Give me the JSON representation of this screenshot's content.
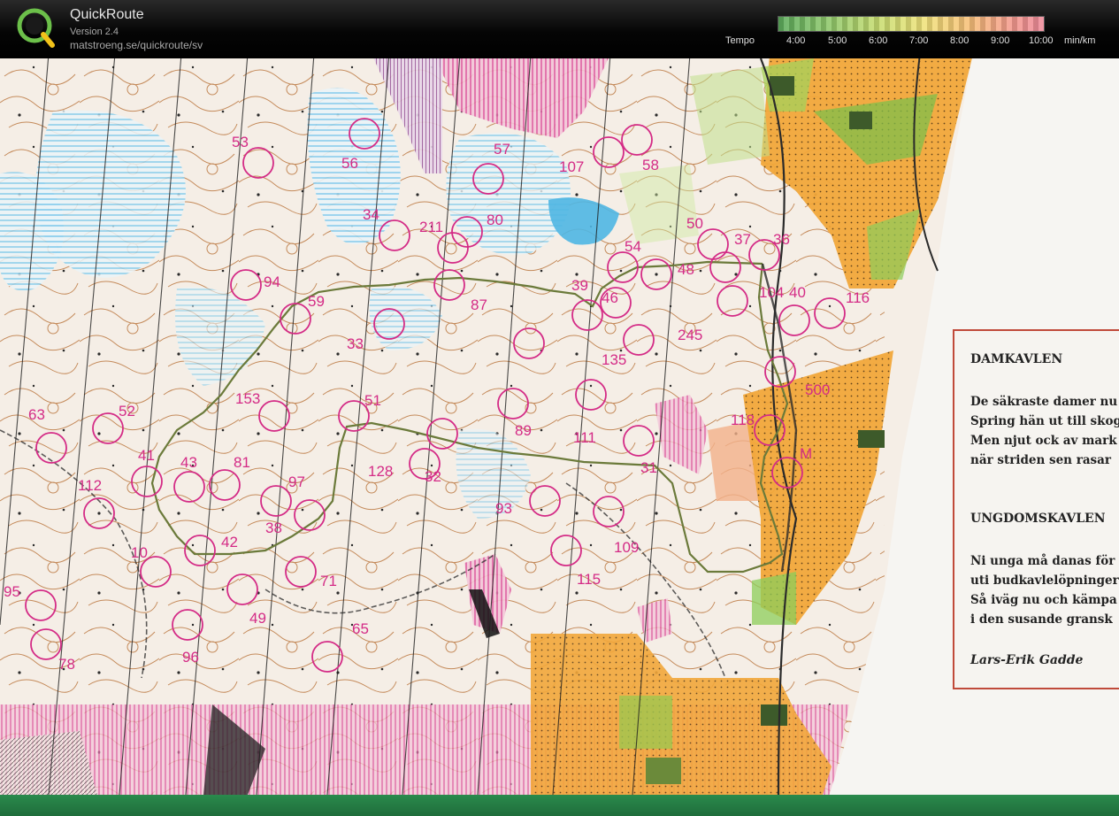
{
  "app": {
    "name": "QuickRoute",
    "version": "Version 2.4",
    "url": "matstroeng.se/quickroute/sv",
    "logo_letter": "Q"
  },
  "tempo": {
    "label": "Tempo",
    "ticks": [
      "4:00",
      "5:00",
      "6:00",
      "7:00",
      "8:00",
      "9:00",
      "10:00"
    ],
    "unit": "min/km",
    "colors": [
      "#5cab5c",
      "#c8dd70",
      "#f0e27a",
      "#f49a8e"
    ]
  },
  "map": {
    "control_labels": [
      "56",
      "57",
      "107",
      "58",
      "53",
      "34",
      "211",
      "80",
      "54",
      "50",
      "37",
      "36",
      "94",
      "59",
      "87",
      "39",
      "46",
      "48",
      "104",
      "40",
      "116",
      "33",
      "135",
      "245",
      "153",
      "51",
      "500",
      "63",
      "52",
      "89",
      "111",
      "118",
      "41",
      "43",
      "81",
      "128",
      "32",
      "31",
      "M",
      "112",
      "97",
      "93",
      "38",
      "109",
      "42",
      "10",
      "115",
      "71",
      "95",
      "49",
      "65",
      "96",
      "78"
    ],
    "colors": {
      "control": "#d42b86",
      "route": "#5a6b3a",
      "paper": "#f5eee6",
      "contour": "#b77a4a",
      "water": "#6fc4ea",
      "field": "#f2a73a"
    }
  },
  "poem": {
    "heading1": "DAMKAVLEN",
    "lines1": [
      "De säkraste damer nu",
      "Spring hän ut till skog",
      "Men njut ock av mark",
      "när striden sen rasar"
    ],
    "heading2": "UNGDOMSKAVLEN",
    "lines2": [
      "Ni unga må danas för",
      "uti budkavlelöpninger",
      "Så iväg nu och kämpa",
      "i den susande gransk"
    ],
    "author": "Lars-Erik Gadde"
  }
}
